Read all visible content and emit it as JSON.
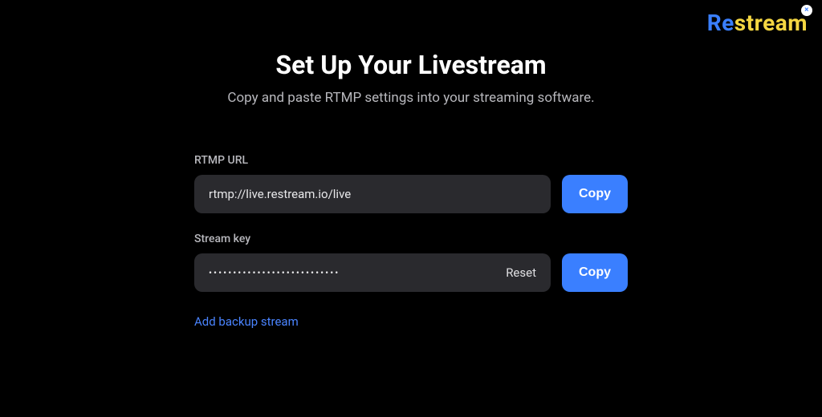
{
  "brand": {
    "name_part1": "Re",
    "name_part2": "stream",
    "close_glyph": "×"
  },
  "header": {
    "title": "Set Up Your Livestream",
    "subtitle": "Copy and paste RTMP settings into your streaming software."
  },
  "fields": {
    "rtmp": {
      "label": "RTMP URL",
      "value": "rtmp://live.restream.io/live",
      "copy_label": "Copy"
    },
    "stream_key": {
      "label": "Stream key",
      "value_mask": "•••••••••••••••••••••••••••",
      "reset_label": "Reset",
      "copy_label": "Copy"
    }
  },
  "links": {
    "add_backup": "Add backup stream"
  }
}
